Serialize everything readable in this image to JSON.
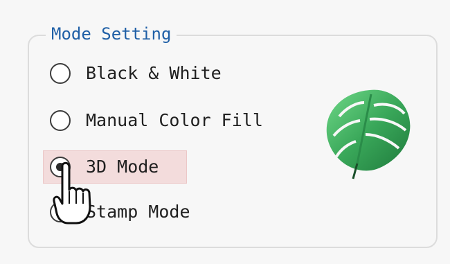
{
  "group": {
    "title": "Mode Setting"
  },
  "options": [
    {
      "label": "Black & White",
      "checked": false
    },
    {
      "label": "Manual Color Fill",
      "checked": false
    },
    {
      "label": "3D Mode",
      "checked": true
    },
    {
      "label": "Stamp Mode",
      "checked": false
    }
  ],
  "preview": {
    "icon": "monstera-leaf-icon"
  },
  "cursor": {
    "icon": "hand-pointer-icon"
  },
  "colors": {
    "title": "#1f5fa6",
    "highlight": "#f3dcdc",
    "leaf_dark": "#1e7a3c",
    "leaf_light": "#5fcf7a"
  }
}
